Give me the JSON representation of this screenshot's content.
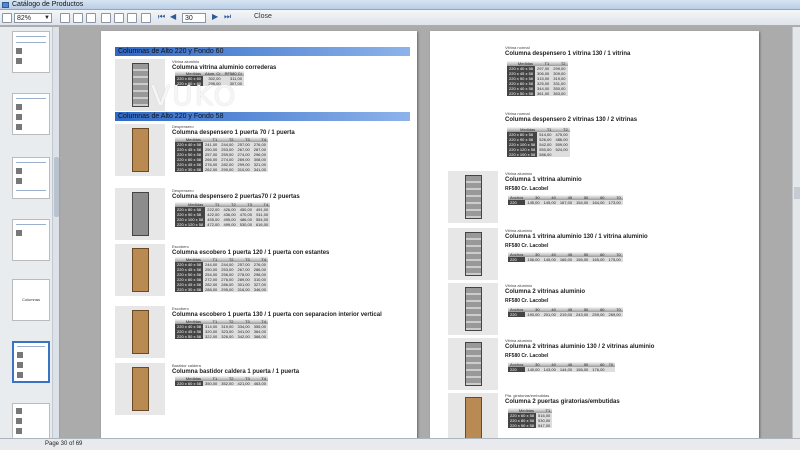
{
  "window": {
    "title": "Catálogo de Productos"
  },
  "toolbar": {
    "zoom": "82%",
    "page_value": "30",
    "page_total": "of 69",
    "close_label": "Close"
  },
  "sidebar": {
    "selected_thumb_caption": "Columnas"
  },
  "status": {
    "text": "Page 30 of 69"
  },
  "left_page": {
    "sections": [
      {
        "title": "Columnas de Alto 220 y Fondo 60"
      },
      {
        "title": "Columnas de Alto 220 y Fondo 58"
      }
    ],
    "items": [
      {
        "label": "Vitrina aluminio",
        "name": "Columna vitrina aluminio correderas",
        "headers": [
          "Medidas",
          "Alum. Cr",
          "RF580 Cr"
        ],
        "rows": [
          [
            "220 x 60 x 60",
            "302,00",
            "311,00"
          ],
          [
            "220 x 60 x 60",
            "295,00",
            "307,00"
          ]
        ]
      },
      {
        "label": "Despensero",
        "name": "Columna despensero 1 puerta 70 / 1 puerta",
        "headers": [
          "Medidas",
          "T1",
          "T2",
          "T3",
          "T4"
        ],
        "rows": [
          [
            "220 x 40 x 58",
            "241,00",
            "244,00",
            "257,00",
            "276,00"
          ],
          [
            "220 x 45 x 58",
            "250,00",
            "253,00",
            "267,00",
            "287,00"
          ],
          [
            "220 x 50 x 58",
            "257,00",
            "259,00",
            "274,00",
            "296,00"
          ],
          [
            "220 x 60 x 58",
            "266,00",
            "274,00",
            "269,00",
            "308,00"
          ],
          [
            "220 x 45 x 58",
            "276,00",
            "282,00",
            "299,00",
            "321,00"
          ],
          [
            "220 x 30 x 58",
            "262,00",
            "290,00",
            "310,00",
            "341,00"
          ]
        ]
      },
      {
        "label": "Despensero",
        "name": "Columna despensero 2 puertas70 / 2 puertas",
        "headers": [
          "Medidas",
          "T1",
          "T2",
          "T3",
          "T4"
        ],
        "rows": [
          [
            "220 x 80 x 58",
            "222,00",
            "426,00",
            "450,00",
            "491,00"
          ],
          [
            "220 x 90 x 58",
            "422,00",
            "436,00",
            "470,00",
            "511,00"
          ],
          [
            "220 x 100 x 58",
            "455,00",
            "495,00",
            "486,00",
            "554,00"
          ],
          [
            "220 x 120 x 58",
            "472,00",
            "499,00",
            "530,00",
            "616,00"
          ]
        ]
      },
      {
        "label": "Escobero",
        "name": "Columna escobero 1 puerta 120 / 1 puerta con estantes",
        "headers": [
          "Medidas",
          "T1",
          "T2",
          "T3",
          "T4"
        ],
        "rows": [
          [
            "220 x 40 x 58",
            "244,00",
            "244,00",
            "257,00",
            "276,00"
          ],
          [
            "220 x 45 x 58",
            "250,00",
            "253,00",
            "267,00",
            "286,00"
          ],
          [
            "220 x 50 x 58",
            "254,00",
            "256,00",
            "278,00",
            "298,00"
          ],
          [
            "220 x 60 x 58",
            "272,00",
            "276,00",
            "289,00",
            "310,00"
          ],
          [
            "220 x 45 x 58",
            "282,00",
            "286,00",
            "301,00",
            "327,00"
          ],
          [
            "220 x 30 x 58",
            "288,00",
            "295,00",
            "316,00",
            "346,00"
          ]
        ]
      },
      {
        "label": "Escobero",
        "name": "Columna escobero 1 puerta 130 / 1 puerta con separacion interior vertical",
        "headers": [
          "Medidas",
          "T1",
          "T2",
          "T3",
          "T4"
        ],
        "rows": [
          [
            "220 x 40 x 58",
            "314,00",
            "319,00",
            "334,00",
            "355,00"
          ],
          [
            "220 x 45 x 58",
            "320,00",
            "323,00",
            "341,00",
            "364,00"
          ],
          [
            "220 x 50 x 58",
            "322,00",
            "326,00",
            "342,00",
            "368,00"
          ]
        ]
      },
      {
        "label": "Bastidor caldera",
        "name": "Columna bastidor caldera 1 puerta / 1 puerta",
        "headers": [
          "Medidas",
          "T1",
          "T2",
          "T3",
          "T4"
        ],
        "rows": [
          [
            "220 x 60 x 58",
            "350,00",
            "352,00",
            "421,00",
            "463,00"
          ]
        ]
      }
    ]
  },
  "right_page": {
    "items": [
      {
        "label": "Vitrina normal",
        "name": "Columna despensero 1 vitrina 130 / 1 vitrina",
        "headers": [
          "Medidas",
          "T1",
          "T2"
        ],
        "rows": [
          [
            "220 x 40 x 58",
            "297,00",
            "299,00"
          ],
          [
            "220 x 45 x 58",
            "306,00",
            "309,00"
          ],
          [
            "220 x 50 x 58",
            "315,00",
            "319,00"
          ],
          [
            "220 x 60 x 58",
            "325,00",
            "331,00"
          ],
          [
            "220 x 40 x 58",
            "344,00",
            "350,00"
          ],
          [
            "220 x 50 x 58",
            "361,00",
            "363,00"
          ]
        ]
      },
      {
        "label": "Vitrina normal",
        "name": "Columna despensero 2 vitrinas 130 / 2 vitrinas",
        "headers": [
          "Medidas",
          "T1",
          "T2"
        ],
        "rows": [
          [
            "220 x 80 x 58",
            "514,00",
            "475,00"
          ],
          [
            "220 x 90 x 58",
            "526,00",
            "486,00"
          ],
          [
            "220 x 100 x 58",
            "542,00",
            "509,00"
          ],
          [
            "220 x 120 x 58",
            "550,00",
            "524,00"
          ],
          [
            "220 x 100 x 58",
            "586,00",
            ""
          ]
        ]
      },
      {
        "label": "Vitrina aluminio",
        "name": "Columna 1 vitrina aluminio",
        "finish": "RF580 Cr. Lacobel",
        "headers": [
          "Anchos",
          "30",
          "40",
          "45",
          "50",
          "60",
          "70"
        ],
        "rows": [
          [
            "220",
            "145,00",
            "145,00",
            "167,00",
            "154,00",
            "164,00",
            "173,00"
          ]
        ]
      },
      {
        "label": "Vitrina aluminio",
        "name": "Columna 1 vitrina aluminio 130 / 1 vitrina aluminio",
        "finish": "RF580 Cr. Lacobel",
        "headers": [
          "Anchos",
          "30",
          "40",
          "45",
          "50",
          "60",
          "70"
        ],
        "rows": [
          [
            "220",
            "156,00",
            "145,00",
            "166,00",
            "156,00",
            "165,00",
            "175,00"
          ]
        ]
      },
      {
        "label": "Vitrina aluminio",
        "name": "Columna 2 vitrinas aluminio",
        "finish": "RF580 Cr. Lacobel",
        "headers": [
          "Anchos",
          "30",
          "40",
          "45",
          "50",
          "60",
          "70"
        ],
        "rows": [
          [
            "220",
            "190,00",
            "201,00",
            "219,00",
            "243,00",
            "259,00",
            "269,00"
          ]
        ]
      },
      {
        "label": "Vitrina aluminio",
        "name": "Columna 2 vitrinas aluminio 130 / 2 vitrinas aluminio",
        "finish": "RF580 Cr. Lacobel",
        "headers": [
          "Anchos",
          "30",
          "40",
          "45",
          "50",
          "60",
          "70"
        ],
        "rows": [
          [
            "220",
            "140,00",
            "143,00",
            "144,00",
            "156,00",
            "176,00",
            ""
          ]
        ]
      },
      {
        "label": "Pta. giratorias/embutidas",
        "name": "Columna 2 puertas giratorias/embutidas",
        "headers": [
          "Medidas",
          "T1"
        ],
        "rows": [
          [
            "220 x 60 x 58",
            "516,00"
          ],
          [
            "220 x 80 x 58",
            "530,00"
          ],
          [
            "220 x 90 x 58",
            "547,00"
          ]
        ]
      }
    ]
  }
}
